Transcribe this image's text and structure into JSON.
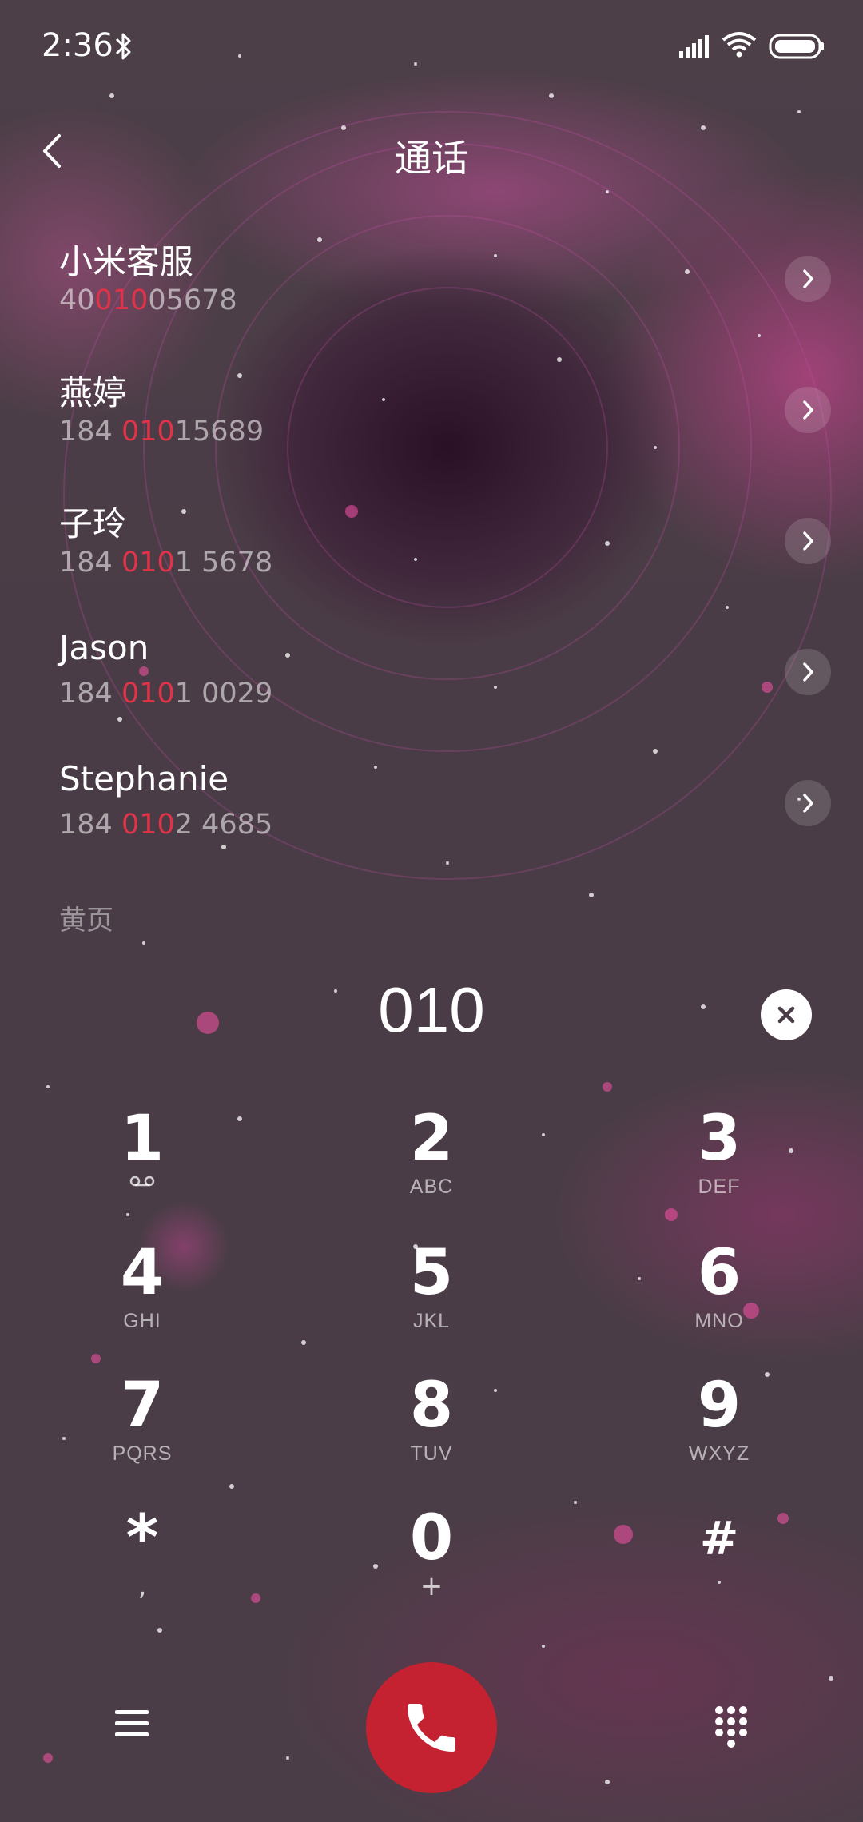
{
  "status_bar": {
    "time": "2:36",
    "icons": [
      "bluetooth-icon",
      "signal-icon",
      "wifi-icon",
      "battery-icon"
    ]
  },
  "header": {
    "title": "通话",
    "back_icon": "chevron-left-icon"
  },
  "contacts": [
    {
      "name": "小米客服",
      "number_parts": [
        "40",
        "010",
        "05678"
      ]
    },
    {
      "name": "燕婷",
      "number_parts": [
        "184 ",
        "010",
        "15689"
      ]
    },
    {
      "name": "子玲",
      "number_parts": [
        "184 ",
        "010",
        "1 5678"
      ]
    },
    {
      "name": "Jason",
      "number_parts": [
        "184 ",
        "010",
        "1 0029"
      ]
    },
    {
      "name": "Stephanie",
      "number_parts": [
        "184 ",
        "010",
        "2 4685"
      ]
    }
  ],
  "section_label": "黄页",
  "dialer": {
    "input": "010",
    "clear_icon": "close-icon"
  },
  "keys": [
    {
      "digit": "1",
      "sub": "",
      "sub_icon": "voicemail-icon"
    },
    {
      "digit": "2",
      "sub": "ABC"
    },
    {
      "digit": "3",
      "sub": "DEF"
    },
    {
      "digit": "4",
      "sub": "GHI"
    },
    {
      "digit": "5",
      "sub": "JKL"
    },
    {
      "digit": "6",
      "sub": "MNO"
    },
    {
      "digit": "7",
      "sub": "PQRS"
    },
    {
      "digit": "8",
      "sub": "TUV"
    },
    {
      "digit": "9",
      "sub": "WXYZ"
    },
    {
      "digit": "*",
      "sub": ","
    },
    {
      "digit": "0",
      "sub": "+"
    },
    {
      "digit": "#",
      "sub": ""
    }
  ],
  "bottom_bar": {
    "menu_icon": "menu-icon",
    "call_icon": "phone-icon",
    "keypad_icon": "dialpad-icon"
  },
  "colors": {
    "highlight": "#e0334a",
    "call_button": "#c42230",
    "background": "#4b3d47"
  }
}
